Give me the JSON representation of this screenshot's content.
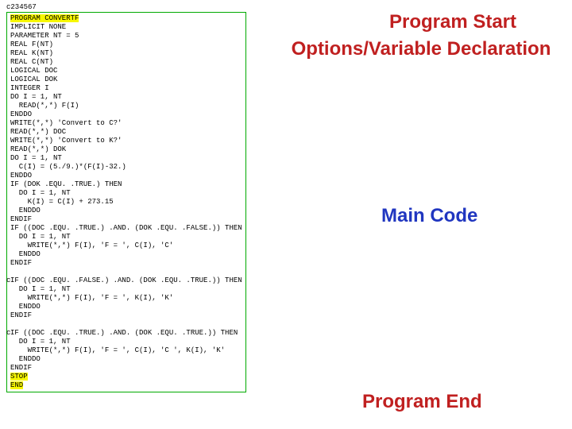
{
  "ruler": "c234567",
  "margin_char": "c",
  "code": {
    "l01": "PROGRAM CONVERTF",
    "l02": "IMPLICIT NONE",
    "l03": "PARAMETER NT = 5",
    "l04": "REAL F(NT)",
    "l05": "REAL K(NT)",
    "l06": "REAL C(NT)",
    "l07": "LOGICAL DOC",
    "l08": "LOGICAL DOK",
    "l09": "INTEGER I",
    "l10": "DO I = 1, NT",
    "l11": "  READ(*,*) F(I)",
    "l12": "ENDDO",
    "l13": "WRITE(*,*) 'Convert to C?'",
    "l14": "READ(*,*) DOC",
    "l15": "WRITE(*,*) 'Convert to K?'",
    "l16": "READ(*,*) DOK",
    "l17": "DO I = 1, NT",
    "l18": "  C(I) = (5./9.)*(F(I)-32.)",
    "l19": "ENDDO",
    "l20": "IF (DOK .EQU. .TRUE.) THEN",
    "l21": "  DO I = 1, NT",
    "l22": "    K(I) = C(I) + 273.15",
    "l23": "  ENDDO",
    "l24": "ENDIF",
    "l25": "IF ((DOC .EQU. .TRUE.) .AND. (DOK .EQU. .FALSE.)) THEN",
    "l26": "  DO I = 1, NT",
    "l27": "    WRITE(*,*) F(I), 'F = ', C(I), 'C'",
    "l28": "  ENDDO",
    "l29": "ENDIF",
    "l30": "",
    "l31": "IF ((DOC .EQU. .FALSE.) .AND. (DOK .EQU. .TRUE.)) THEN",
    "l32": "  DO I = 1, NT",
    "l33": "    WRITE(*,*) F(I), 'F = ', K(I), 'K'",
    "l34": "  ENDDO",
    "l35": "ENDIF",
    "l36": "",
    "l37": "IF ((DOC .EQU. .TRUE.) .AND. (DOK .EQU. .TRUE.)) THEN",
    "l38": "  DO I = 1, NT",
    "l39": "    WRITE(*,*) F(I), 'F = ', C(I), 'C ', K(I), 'K'",
    "l40": "  ENDDO",
    "l41": "ENDIF",
    "l42": "STOP",
    "l43": "END"
  },
  "labels": {
    "title": "Program Start",
    "options": "Options/Variable Declaration",
    "main": "Main Code",
    "end": "Program End"
  }
}
